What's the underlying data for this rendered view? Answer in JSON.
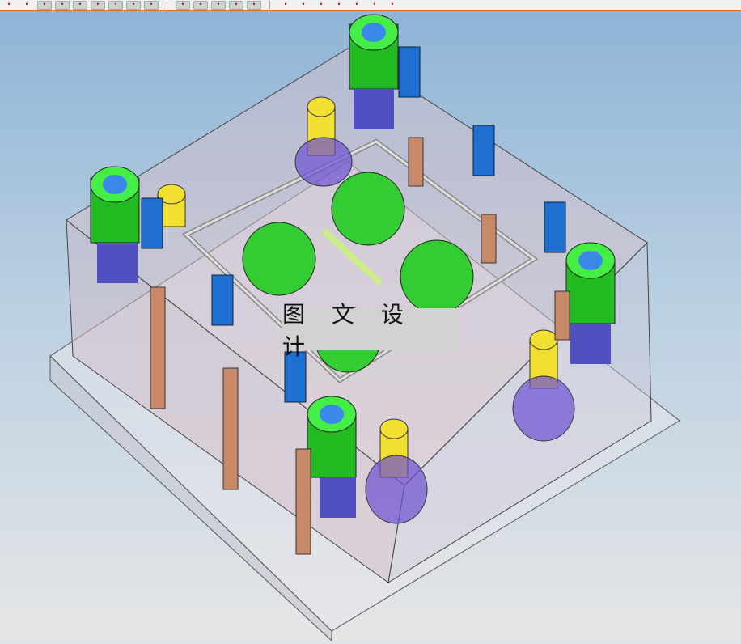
{
  "toolbar": {
    "buttons": [
      "view-cube",
      "shaded-box",
      "snap-points",
      "line-tool",
      "point-tool",
      "arc-tool",
      "vertex-snap",
      "axis-tool",
      "circle-center",
      "tangent",
      "midpoint",
      "endpoint",
      "plane",
      "grid",
      "measure",
      "edit",
      "undo",
      "report",
      "hide",
      "box",
      "render"
    ]
  },
  "viewport": {
    "watermark": "图 文 设 计"
  },
  "colors": {
    "accent": "#e8742c",
    "green": "#22cc22",
    "blue": "#1e6fd0",
    "yellow": "#f2e030",
    "purple": "#6a5acd",
    "copper": "#c98868"
  }
}
